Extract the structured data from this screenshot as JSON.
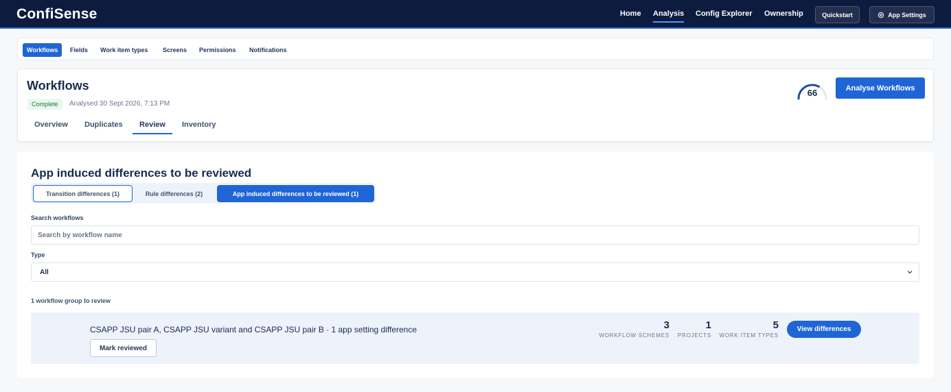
{
  "app": {
    "name": "ConfiSense",
    "nav": [
      "Home",
      "Analysis",
      "Config Explorer",
      "Ownership"
    ],
    "active_nav": "Analysis",
    "quickstart": "Quickstart",
    "settings": "App Settings",
    "settings_icon": "gear-icon"
  },
  "section_nav": {
    "items": [
      "Workflows",
      "Fields",
      "Work item types",
      "Screens",
      "Permissions",
      "Notifications"
    ],
    "active": "Workflows"
  },
  "page": {
    "title": "Workflows",
    "status": "Complete",
    "analysed": "Analysed 30 Sept 2026, 7:13 PM",
    "score": "66",
    "score_fraction": 0.66,
    "analyse_button": "Analyse Workflows",
    "tabs": [
      "Overview",
      "Duplicates",
      "Review",
      "Inventory"
    ],
    "active_tab": "Review"
  },
  "review": {
    "heading": "App induced differences to be reviewed",
    "filters": [
      "Transition differences (1)",
      "Rule differences (2)",
      "App induced differences to be reviewed (1)"
    ],
    "active_filter": "App induced differences to be reviewed (1)",
    "search_label": "Search workflows",
    "search_placeholder": "Search by workflow name",
    "search_value": "",
    "type_label": "Type",
    "type_value": "All",
    "count_text": "1 workflow group to review",
    "group": {
      "title": "CSAPP JSU pair A, CSAPP JSU variant and CSAPP JSU pair B · 1 app setting difference",
      "mark_reviewed": "Mark reviewed",
      "stats": [
        {
          "value": "3",
          "label": "WORKFLOW SCHEMES"
        },
        {
          "value": "1",
          "label": "PROJECTS"
        },
        {
          "value": "5",
          "label": "WORK ITEM TYPES"
        }
      ],
      "view_button": "View differences"
    }
  },
  "colors": {
    "topbar": "#0d1b3e",
    "accent": "#1f65d6",
    "success_bg": "#e8f8ee",
    "success_text": "#22733d"
  }
}
